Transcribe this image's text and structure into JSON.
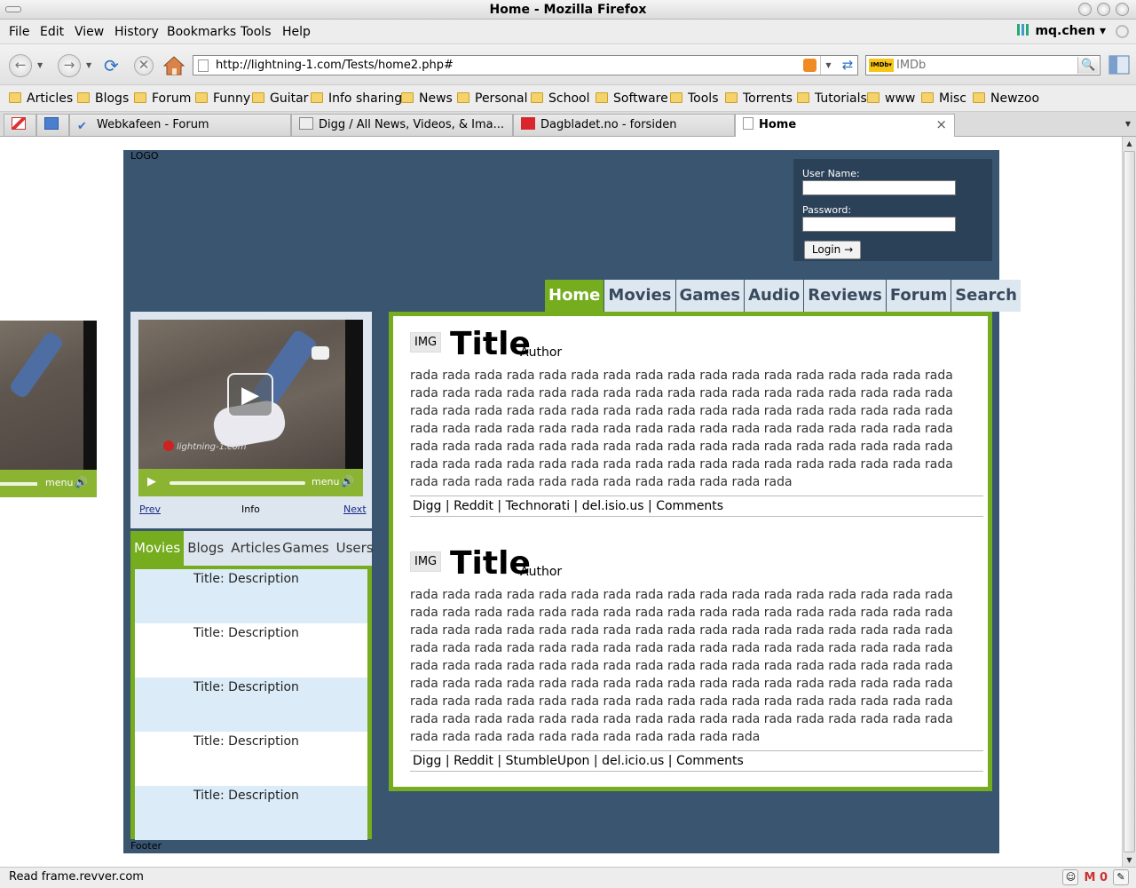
{
  "window": {
    "title": "Home - Mozilla Firefox"
  },
  "menu": [
    "File",
    "Edit",
    "View",
    "History",
    "Bookmarks",
    "Tools",
    "Help"
  ],
  "user": "mq.chen",
  "address": {
    "url": "http://lightning-1.com/Tests/home2.php#"
  },
  "search": {
    "placeholder": "IMDb",
    "engine_icon": "imdb-icon"
  },
  "bookmarks": [
    "Articles",
    "Blogs",
    "Forum",
    "Funny",
    "Guitar",
    "Info sharing",
    "News",
    "Personal",
    "School",
    "Software",
    "Tools",
    "Torrents",
    "Tutorials",
    "www",
    "Misc",
    "Newzoo"
  ],
  "tabs": [
    {
      "label": "",
      "icon": "gmail-icon"
    },
    {
      "label": "",
      "icon": "reader-icon"
    },
    {
      "label": "Webkafeen - Forum",
      "icon": "webkafeen-icon"
    },
    {
      "label": "Digg / All News, Videos, & Ima...",
      "icon": "digg-icon"
    },
    {
      "label": "Dagbladet.no - forsiden",
      "icon": "dagbladet-icon"
    },
    {
      "label": "Home",
      "icon": "page-icon",
      "active": true
    }
  ],
  "status": {
    "text": "Read frame.revver.com",
    "gmail_count": "0"
  },
  "page": {
    "logo": "LOGO",
    "footer": "Footer",
    "login": {
      "username_label": "User Name:",
      "password_label": "Password:",
      "button": "Login →"
    },
    "nav": [
      "Home",
      "Movies",
      "Games",
      "Audio",
      "Reviews",
      "Forum",
      "Search"
    ],
    "nav_active": "Home",
    "player": {
      "menu": "menu",
      "watermark": "lightning-1.com",
      "prev": "Prev",
      "info": "Info",
      "next": "Next"
    },
    "sidetabs": [
      "Movies",
      "Blogs",
      "Articles",
      "Games",
      "Users"
    ],
    "sidetab_active": "Movies",
    "list": [
      "Title: Description",
      "Title: Description",
      "Title: Description",
      "Title: Description",
      "Title: Description"
    ],
    "posts": [
      {
        "img": "IMG",
        "title": "Title",
        "author": "Author",
        "body": "rada rada rada rada rada rada rada rada rada rada rada rada rada rada rada rada rada rada rada rada rada rada rada rada rada rada rada rada rada rada rada rada rada rada rada rada rada rada rada rada rada rada rada rada rada rada rada rada rada rada rada rada rada rada rada rada rada rada rada rada rada rada rada rada rada rada rada rada rada rada rada rada rada rada rada rada rada rada rada rada rada rada rada rada rada rada rada rada rada rada rada rada rada rada rada rada rada rada rada rada rada rada rada rada rada rada rada rada rada rada rada rada rada rada",
        "links": [
          "Digg",
          "Reddit",
          "Technorati",
          "del.isio.us",
          "Comments"
        ]
      },
      {
        "img": "IMG",
        "title": "Title",
        "author": "Author",
        "body": "rada rada rada rada rada rada rada rada rada rada rada rada rada rada rada rada rada rada rada rada rada rada rada rada rada rada rada rada rada rada rada rada rada rada rada rada rada rada rada rada rada rada rada rada rada rada rada rada rada rada rada rada rada rada rada rada rada rada rada rada rada rada rada rada rada rada rada rada rada rada rada rada rada rada rada rada rada rada rada rada rada rada rada rada rada rada rada rada rada rada rada rada rada rada rada rada rada rada rada rada rada rada rada rada rada rada rada rada rada rada rada rada rada rada rada rada rada rada rada rada rada rada rada rada rada rada rada rada rada rada rada rada rada rada rada rada rada rada rada rada rada rada rada rada rada rada rada",
        "links": [
          "Digg",
          "Reddit",
          "StumbleUpon",
          "del.icio.us",
          "Comments"
        ]
      }
    ]
  },
  "colors": {
    "site_bg": "#3a5570",
    "accent_green": "#75ad1f",
    "nav_inactive": "#dde7f0",
    "login_bg": "#2b4158",
    "list_alt": "#dbecf8"
  }
}
